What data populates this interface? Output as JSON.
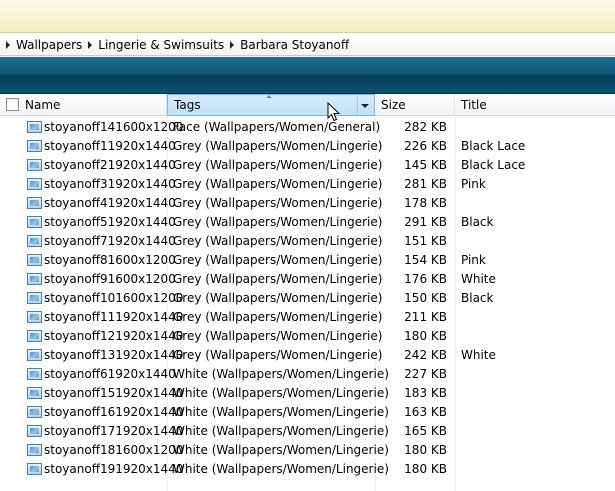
{
  "breadcrumb": [
    "Wallpapers",
    "Lingerie & Swimsuits",
    "Barbara Stoyanoff"
  ],
  "columns": {
    "name": "Name",
    "tags": "Tags",
    "size": "Size",
    "title": "Title"
  },
  "files": [
    {
      "name": "stoyanoff141600x1200",
      "tags": "Face (Wallpapers/Women/General)",
      "size": "282 KB",
      "title": ""
    },
    {
      "name": "stoyanoff11920x1440",
      "tags": "Grey (Wallpapers/Women/Lingerie)",
      "size": "226 KB",
      "title": "Black Lace"
    },
    {
      "name": "stoyanoff21920x1440",
      "tags": "Grey (Wallpapers/Women/Lingerie)",
      "size": "145 KB",
      "title": "Black Lace"
    },
    {
      "name": "stoyanoff31920x1440",
      "tags": "Grey (Wallpapers/Women/Lingerie)",
      "size": "281 KB",
      "title": "Pink"
    },
    {
      "name": "stoyanoff41920x1440",
      "tags": "Grey (Wallpapers/Women/Lingerie)",
      "size": "178 KB",
      "title": ""
    },
    {
      "name": "stoyanoff51920x1440",
      "tags": "Grey (Wallpapers/Women/Lingerie)",
      "size": "291 KB",
      "title": "Black"
    },
    {
      "name": "stoyanoff71920x1440",
      "tags": "Grey (Wallpapers/Women/Lingerie)",
      "size": "151 KB",
      "title": ""
    },
    {
      "name": "stoyanoff81600x1200",
      "tags": "Grey (Wallpapers/Women/Lingerie)",
      "size": "154 KB",
      "title": "Pink"
    },
    {
      "name": "stoyanoff91600x1200",
      "tags": "Grey (Wallpapers/Women/Lingerie)",
      "size": "176 KB",
      "title": "White"
    },
    {
      "name": "stoyanoff101600x1200",
      "tags": "Grey (Wallpapers/Women/Lingerie)",
      "size": "150 KB",
      "title": "Black"
    },
    {
      "name": "stoyanoff111920x1440",
      "tags": "Grey (Wallpapers/Women/Lingerie)",
      "size": "211 KB",
      "title": ""
    },
    {
      "name": "stoyanoff121920x1440",
      "tags": "Grey (Wallpapers/Women/Lingerie)",
      "size": "180 KB",
      "title": ""
    },
    {
      "name": "stoyanoff131920x1440",
      "tags": "Grey (Wallpapers/Women/Lingerie)",
      "size": "242 KB",
      "title": "White"
    },
    {
      "name": "stoyanoff61920x1440",
      "tags": "White (Wallpapers/Women/Lingerie)",
      "size": "227 KB",
      "title": ""
    },
    {
      "name": "stoyanoff151920x1440",
      "tags": "White (Wallpapers/Women/Lingerie)",
      "size": "183 KB",
      "title": ""
    },
    {
      "name": "stoyanoff161920x1440",
      "tags": "White (Wallpapers/Women/Lingerie)",
      "size": "163 KB",
      "title": ""
    },
    {
      "name": "stoyanoff171920x1440",
      "tags": "White (Wallpapers/Women/Lingerie)",
      "size": "165 KB",
      "title": ""
    },
    {
      "name": "stoyanoff181600x1200",
      "tags": "White (Wallpapers/Women/Lingerie)",
      "size": "180 KB",
      "title": ""
    },
    {
      "name": "stoyanoff191920x1440",
      "tags": "White (Wallpapers/Women/Lingerie)",
      "size": "180 KB",
      "title": ""
    }
  ],
  "icons": {
    "file": "image-file-icon",
    "crumb": "chevron-right-icon",
    "cursor": "mouse-pointer-icon"
  },
  "colors": {
    "band": "#0e5677",
    "header_hover": "#bfe0f6"
  }
}
